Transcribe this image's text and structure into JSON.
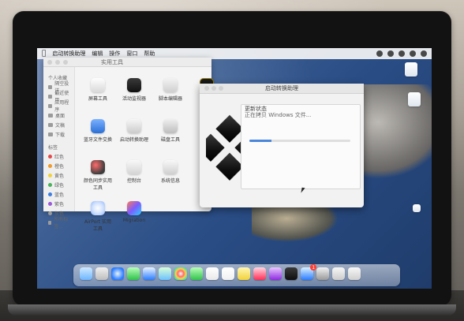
{
  "menubar": {
    "apple": "",
    "items": [
      "启动转换助理",
      "编辑",
      "操作",
      "窗口",
      "帮助"
    ]
  },
  "finder": {
    "title": "实用工具",
    "sidebar": [
      {
        "label": "个人收藏"
      },
      {
        "label": "隔空投送"
      },
      {
        "label": "最近使用"
      },
      {
        "label": "应用程序"
      },
      {
        "label": "桌面"
      },
      {
        "label": "文稿"
      },
      {
        "label": "下载"
      },
      {
        "label": "标签"
      },
      {
        "label": "红色"
      },
      {
        "label": "橙色"
      },
      {
        "label": "黄色"
      },
      {
        "label": "绿色"
      },
      {
        "label": "蓝色"
      },
      {
        "label": "紫色"
      },
      {
        "label": "灰色"
      },
      {
        "label": "所有标签..."
      }
    ],
    "apps": [
      {
        "label": "屏幕工具"
      },
      {
        "label": "活动监视器"
      },
      {
        "label": "脚本编辑器"
      },
      {
        "label": ""
      },
      {
        "label": "蓝牙文件交换"
      },
      {
        "label": "启动转换助理"
      },
      {
        "label": "磁盘工具"
      },
      {
        "label": ""
      },
      {
        "label": "颜色同步实用工具"
      },
      {
        "label": "控制台"
      },
      {
        "label": "系统信息"
      },
      {
        "label": ""
      },
      {
        "label": "AirPort 实用工具"
      },
      {
        "label": "Migration"
      },
      {
        "label": ""
      },
      {
        "label": ""
      }
    ]
  },
  "bootcamp": {
    "title": "启动转换助理",
    "panel_title": "更新状态",
    "status": "正在拷贝 Windows 文件...",
    "progress": 0.22
  },
  "dock": {
    "icons": [
      "finder",
      "launchpad",
      "safari",
      "messages",
      "mail",
      "maps",
      "photos",
      "facetime",
      "calendar",
      "reminders",
      "notes",
      "music",
      "podcasts",
      "tv",
      "app-store",
      "system-preferences",
      "bootcamp",
      "trash"
    ],
    "badge_count": "1"
  }
}
